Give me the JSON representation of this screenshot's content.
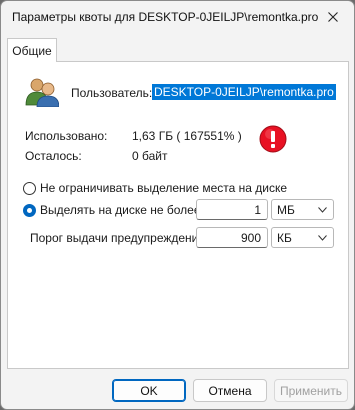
{
  "window": {
    "title": "Параметры квоты для DESKTOP-0JEILJP\\remontka.pro"
  },
  "tabs": [
    {
      "label": "Общие"
    }
  ],
  "user": {
    "label": "Пользователь:",
    "value": "DESKTOP-0JEILJP\\remontka.pro"
  },
  "stats": {
    "used_label": "Использовано:",
    "used_value": "1,63 ГБ ( 167551% )",
    "remaining_label": "Осталось:",
    "remaining_value": "0 байт"
  },
  "options": {
    "no_limit_label": "Не ограничивать выделение места на диске",
    "limit_label": "Выделять на диске не более",
    "selected": "limit"
  },
  "limit": {
    "value": "1",
    "unit": "МБ"
  },
  "warning": {
    "label": "Порог выдачи предупреждений",
    "value": "900",
    "unit": "КБ"
  },
  "buttons": {
    "ok": "OK",
    "cancel": "Отмена",
    "apply": "Применить"
  },
  "colors": {
    "selection": "#0078d7",
    "accent": "#0067c0",
    "error": "#e81123"
  },
  "icons": [
    "users-icon",
    "error-icon",
    "close-icon",
    "chevron-down-icon"
  ]
}
